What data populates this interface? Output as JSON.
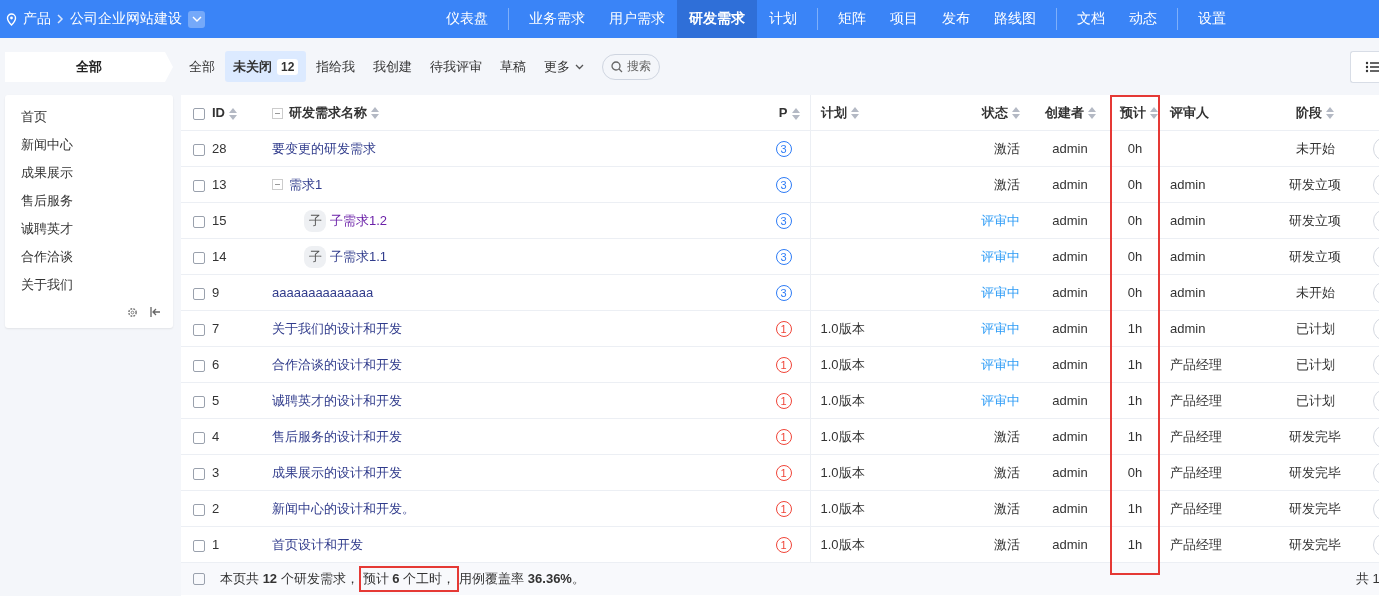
{
  "breadcrumb": {
    "root": "产品",
    "product": "公司企业网站建设"
  },
  "nav_groups": [
    [
      {
        "label": "仪表盘",
        "selected": false
      }
    ],
    [
      {
        "label": "业务需求",
        "selected": false
      },
      {
        "label": "用户需求",
        "selected": false
      },
      {
        "label": "研发需求",
        "selected": true
      },
      {
        "label": "计划",
        "selected": false
      }
    ],
    [
      {
        "label": "矩阵",
        "selected": false
      },
      {
        "label": "项目",
        "selected": false
      },
      {
        "label": "发布",
        "selected": false
      },
      {
        "label": "路线图",
        "selected": false
      }
    ],
    [
      {
        "label": "文档",
        "selected": false
      },
      {
        "label": "动态",
        "selected": false
      }
    ],
    [
      {
        "label": "设置",
        "selected": false
      }
    ]
  ],
  "sidebar": {
    "title": "全部",
    "items": [
      "首页",
      "新闻中心",
      "成果展示",
      "售后服务",
      "诚聘英才",
      "合作洽谈",
      "关于我们"
    ]
  },
  "filter_tabs": [
    {
      "label": "全部",
      "selected": false
    },
    {
      "label": "未关闭",
      "selected": true,
      "count": "12"
    },
    {
      "label": "指给我",
      "selected": false
    },
    {
      "label": "我创建",
      "selected": false
    },
    {
      "label": "待我评审",
      "selected": false
    },
    {
      "label": "草稿",
      "selected": false
    },
    {
      "label": "更多",
      "selected": false,
      "kind": "dropdown"
    }
  ],
  "search": {
    "label": "搜索"
  },
  "table": {
    "select_all_checked": false,
    "columns": [
      {
        "label": "ID",
        "sortable": true,
        "highlighted": false
      },
      {
        "label": "研发需求名称",
        "sortable": true,
        "highlighted": false
      },
      {
        "label": "P",
        "sortable": true,
        "highlighted": false
      },
      {
        "label": "计划",
        "sortable": true,
        "highlighted": false
      },
      {
        "label": "状态",
        "sortable": true,
        "highlighted": false
      },
      {
        "label": "创建者",
        "sortable": true,
        "highlighted": false
      },
      {
        "label": "预计",
        "sortable": true,
        "highlighted": true
      },
      {
        "label": "评审人",
        "sortable": false,
        "highlighted": false
      },
      {
        "label": "阶段",
        "sortable": true,
        "highlighted": false
      }
    ],
    "rows": [
      {
        "checked": false,
        "id": "28",
        "name": {
          "text": "要变更的研发需求",
          "color": "#313c8c"
        },
        "priority": {
          "text": "3",
          "color": "#2e7cf6"
        },
        "status": {
          "text": "激活"
        },
        "creator": "admin",
        "estimate": "0h",
        "stage": "未开始"
      },
      {
        "checked": false,
        "id": "13",
        "name": {
          "text": "需求1",
          "color": "#313c8c"
        },
        "expanded": true,
        "priority": {
          "text": "3",
          "color": "#2e7cf6"
        },
        "status": {
          "text": "激活"
        },
        "creator": "admin",
        "estimate": "0h",
        "reviewer": "admin",
        "stage": "研发立项",
        "children": [
          {
            "checked": false,
            "id": "15",
            "badge": "子",
            "name": {
              "text": "子需求1.2",
              "color": "#6b21a8"
            },
            "priority": {
              "text": "3",
              "color": "#2e7cf6"
            },
            "status": {
              "text": "评审中",
              "color": "#2e9cf6"
            },
            "creator": "admin",
            "estimate": "0h",
            "reviewer": "admin",
            "stage": "研发立项"
          },
          {
            "checked": false,
            "id": "14",
            "badge": "子",
            "name": {
              "text": "子需求1.1",
              "color": "#313c8c"
            },
            "priority": {
              "text": "3",
              "color": "#2e7cf6"
            },
            "status": {
              "text": "评审中",
              "color": "#2e9cf6"
            },
            "creator": "admin",
            "estimate": "0h",
            "reviewer": "admin",
            "stage": "研发立项"
          }
        ]
      },
      {
        "checked": false,
        "id": "9",
        "name": {
          "text": "aaaaaaaaaaaaaa",
          "color": "#313c8c"
        },
        "priority": {
          "text": "3",
          "color": "#2e7cf6"
        },
        "status": {
          "text": "评审中",
          "color": "#2e9cf6"
        },
        "creator": "admin",
        "estimate": "0h",
        "reviewer": "admin",
        "stage": "未开始"
      },
      {
        "checked": false,
        "id": "7",
        "name": {
          "text": "关于我们的设计和开发",
          "color": "#313c8c"
        },
        "priority": {
          "text": "1",
          "color": "#f04438"
        },
        "plan": "1.0版本",
        "status": {
          "text": "评审中",
          "color": "#2e9cf6"
        },
        "creator": "admin",
        "estimate": "1h",
        "reviewer": "admin",
        "stage": "已计划"
      },
      {
        "checked": false,
        "id": "6",
        "name": {
          "text": "合作洽谈的设计和开发",
          "color": "#313c8c"
        },
        "priority": {
          "text": "1",
          "color": "#f04438"
        },
        "plan": "1.0版本",
        "status": {
          "text": "评审中",
          "color": "#2e9cf6"
        },
        "creator": "admin",
        "estimate": "1h",
        "reviewer": "产品经理",
        "stage": "已计划"
      },
      {
        "checked": false,
        "id": "5",
        "name": {
          "text": "诚聘英才的设计和开发",
          "color": "#313c8c"
        },
        "priority": {
          "text": "1",
          "color": "#f04438"
        },
        "plan": "1.0版本",
        "status": {
          "text": "评审中",
          "color": "#2e9cf6"
        },
        "creator": "admin",
        "estimate": "1h",
        "reviewer": "产品经理",
        "stage": "已计划"
      },
      {
        "checked": false,
        "id": "4",
        "name": {
          "text": "售后服务的设计和开发",
          "color": "#313c8c"
        },
        "priority": {
          "text": "1",
          "color": "#f04438"
        },
        "plan": "1.0版本",
        "status": {
          "text": "激活"
        },
        "creator": "admin",
        "estimate": "1h",
        "reviewer": "产品经理",
        "stage": "研发完毕"
      },
      {
        "checked": false,
        "id": "3",
        "name": {
          "text": "成果展示的设计和开发",
          "color": "#313c8c"
        },
        "priority": {
          "text": "1",
          "color": "#f04438"
        },
        "plan": "1.0版本",
        "status": {
          "text": "激活"
        },
        "creator": "admin",
        "estimate": "0h",
        "reviewer": "产品经理",
        "stage": "研发完毕"
      },
      {
        "checked": false,
        "id": "2",
        "name": {
          "text": "新闻中心的设计和开发。",
          "color": "#313c8c"
        },
        "priority": {
          "text": "1",
          "color": "#f04438"
        },
        "plan": "1.0版本",
        "status": {
          "text": "激活"
        },
        "creator": "admin",
        "estimate": "1h",
        "reviewer": "产品经理",
        "stage": "研发完毕"
      },
      {
        "checked": false,
        "id": "1",
        "name": {
          "text": "首页设计和开发",
          "color": "#313c8c"
        },
        "priority": {
          "text": "1",
          "color": "#f04438"
        },
        "plan": "1.0版本",
        "status": {
          "text": "激活"
        },
        "creator": "admin",
        "estimate": "1h",
        "reviewer": "产品经理",
        "stage": "研发完毕"
      }
    ]
  },
  "footer": {
    "checked": false,
    "summary_parts": [
      {
        "text": "本页共 **12** 个研发需求，",
        "highlighted": false
      },
      {
        "text": "预计 **6** 个工时，",
        "highlighted": true
      },
      {
        "text": "用例覆盖率 **36.36%**。",
        "highlighted": false
      }
    ],
    "pager": "共 1"
  }
}
